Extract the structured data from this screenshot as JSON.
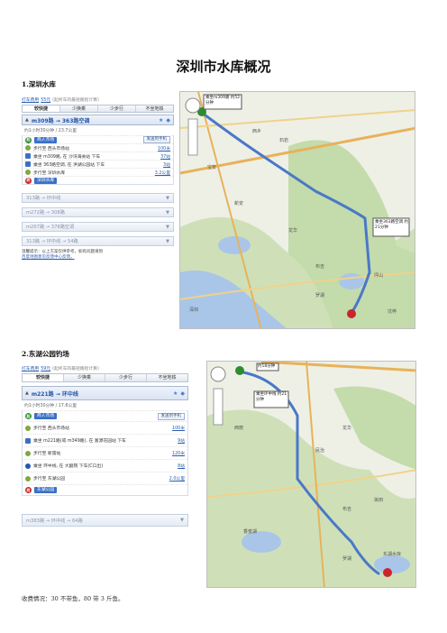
{
  "page_title": "深圳市水库概况",
  "section1": {
    "heading": "1.深圳水库",
    "topline": {
      "fare_label": "打车费用",
      "fare_value": "55元",
      "note": "(起终车的最短路程计算)"
    },
    "tabs": [
      "较快捷",
      "少换乘",
      "少步行",
      "不坐地铁"
    ],
    "route": {
      "name": "m309路 → 363路空调",
      "summary": "约1小时30分钟 / 23.7公里"
    },
    "start": {
      "name": "商人市场",
      "send": "发送到手机"
    },
    "steps": [
      {
        "icon": "walk",
        "text": "步行至 西头市场站",
        "dist": "100米"
      },
      {
        "icon": "bus",
        "text": "乘坐 m309路, 在 沙湾海关站 下车",
        "dist": "37站"
      },
      {
        "icon": "bus",
        "text": "乘坐 363路空调, 在 洪湖公园站 下车",
        "dist": "3站"
      },
      {
        "icon": "walk",
        "text": "步行至 深圳水库",
        "dist": "3.2公里"
      }
    ],
    "end": {
      "name": "深圳水库"
    },
    "alternatives": [
      "313路 → 环中线",
      "m272路 → 308路",
      "m267路 → 378路空调",
      "313路 → 环中线 → 54路"
    ],
    "footnote_lines": [
      "温馨提示：以上方案仅供参考，如有问题请到",
      "百度地图意见反馈中心反馈。"
    ],
    "map_labels": {
      "callout1": "乘坐m309路 约52分钟",
      "callout2": "乘坐363路空调 约21分钟",
      "places": [
        "西乡",
        "新安",
        "宝安",
        "石岩",
        "龙华",
        "布吉",
        "坪山",
        "坑梓",
        "罗湖",
        "深圳"
      ]
    }
  },
  "section2": {
    "heading": "2.东湖公园钓场",
    "topline": {
      "fare_label": "打车费用",
      "fare_value": "59元",
      "note": "(起终车的最短路程计算)"
    },
    "tabs": [
      "较快捷",
      "少换乘",
      "少步行",
      "不坐地铁"
    ],
    "route": {
      "name": "m221路 → 环中线",
      "summary": "约1小时30分钟 / 17.8公里"
    },
    "start": {
      "name": "商人市场",
      "send": "发送到手机"
    },
    "steps": [
      {
        "icon": "walk",
        "text": "步行至 西头市场站",
        "dist": "100米"
      },
      {
        "icon": "bus",
        "text": "乘坐 m221路(或 m349路), 在 富源花园站 下车",
        "dist": "9站"
      },
      {
        "icon": "walk",
        "text": "步行至 新雷站",
        "dist": "120米"
      },
      {
        "icon": "metro",
        "text": "乘坐 环中线, 在 大剧院 下车(C口出)",
        "dist": "8站"
      },
      {
        "icon": "walk",
        "text": "步行至 东湖公园",
        "dist": "2.0公里"
      }
    ],
    "end": {
      "name": "东湖公园"
    },
    "alternatives": [
      "m383路 → 环中线 → 64路"
    ],
    "map_labels": {
      "callout1": "约18分钟",
      "callout2": "乘坐环中线 约21分钟",
      "places": [
        "西丽",
        "龙华",
        "民治",
        "坂田",
        "布吉",
        "香蜜湖",
        "罗湖",
        "东湖水库"
      ]
    }
  },
  "caption": "收费情况：30 不带鱼，80 带 3 斤鱼。",
  "colors": {
    "route_blue": "#4a78c8",
    "water": "#a9c6e8",
    "green": "#c9ddb4",
    "road_orange": "#e8b25a"
  }
}
